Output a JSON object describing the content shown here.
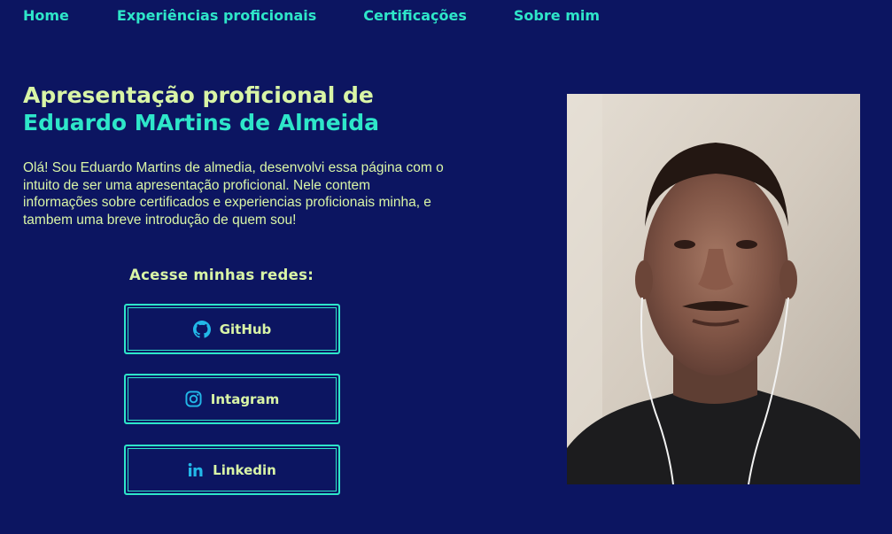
{
  "nav": {
    "items": [
      {
        "label": "Home"
      },
      {
        "label": "Experiências proficionais"
      },
      {
        "label": "Certificações"
      },
      {
        "label": "Sobre mim"
      }
    ]
  },
  "hero": {
    "title_line1": "Apresentação proficional de",
    "title_line2": "Eduardo MArtins de Almeida",
    "intro": "Olá! Sou Eduardo Martins de almedia, desenvolvi essa página com o intuito de ser uma apresentação proficional. Nele contem informações sobre certificados e experiencias proficionais minha, e tambem uma breve introdução de quem sou!"
  },
  "social": {
    "title": "Acesse minhas redes:",
    "buttons": [
      {
        "label": "GitHub",
        "icon": "github-icon"
      },
      {
        "label": "Intagram",
        "icon": "instagram-icon"
      },
      {
        "label": "Linkedin",
        "icon": "linkedin-icon"
      }
    ]
  },
  "colors": {
    "background": "#0c1561",
    "accent": "#2ee6c9",
    "text": "#d9f5a6"
  },
  "photo": {
    "alt": "profile-photo"
  }
}
